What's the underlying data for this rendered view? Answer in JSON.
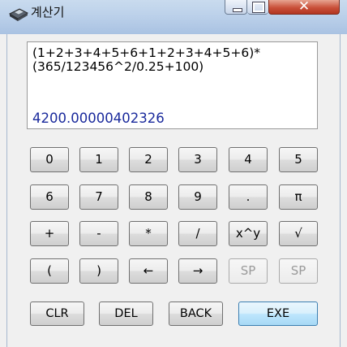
{
  "window": {
    "title": "계산기",
    "close_glyph": "✕"
  },
  "display": {
    "expression_line1": "(1+2+3+4+5+6+1+2+3+4+5+6)*",
    "expression_line2": "(365/123456^2/0.25+100)",
    "result": "4200.00000402326"
  },
  "keys": {
    "row1": [
      "0",
      "1",
      "2",
      "3",
      "4",
      "5"
    ],
    "row2": [
      "6",
      "7",
      "8",
      "9",
      ".",
      "π"
    ],
    "row3": [
      "+",
      "-",
      "*",
      "/",
      "x^y",
      "√"
    ],
    "row4": [
      "(",
      ")",
      "←",
      "→",
      "SP",
      "SP"
    ],
    "row4_disabled": [
      false,
      false,
      false,
      false,
      true,
      true
    ]
  },
  "actions": {
    "clr": "CLR",
    "del": "DEL",
    "back": "BACK",
    "exe": "EXE"
  },
  "colors": {
    "result_text": "#1a2a9c",
    "titlebar": "#bcd1ea",
    "close_button": "#c9503a"
  },
  "icons": {
    "app": "calculator-icon"
  }
}
